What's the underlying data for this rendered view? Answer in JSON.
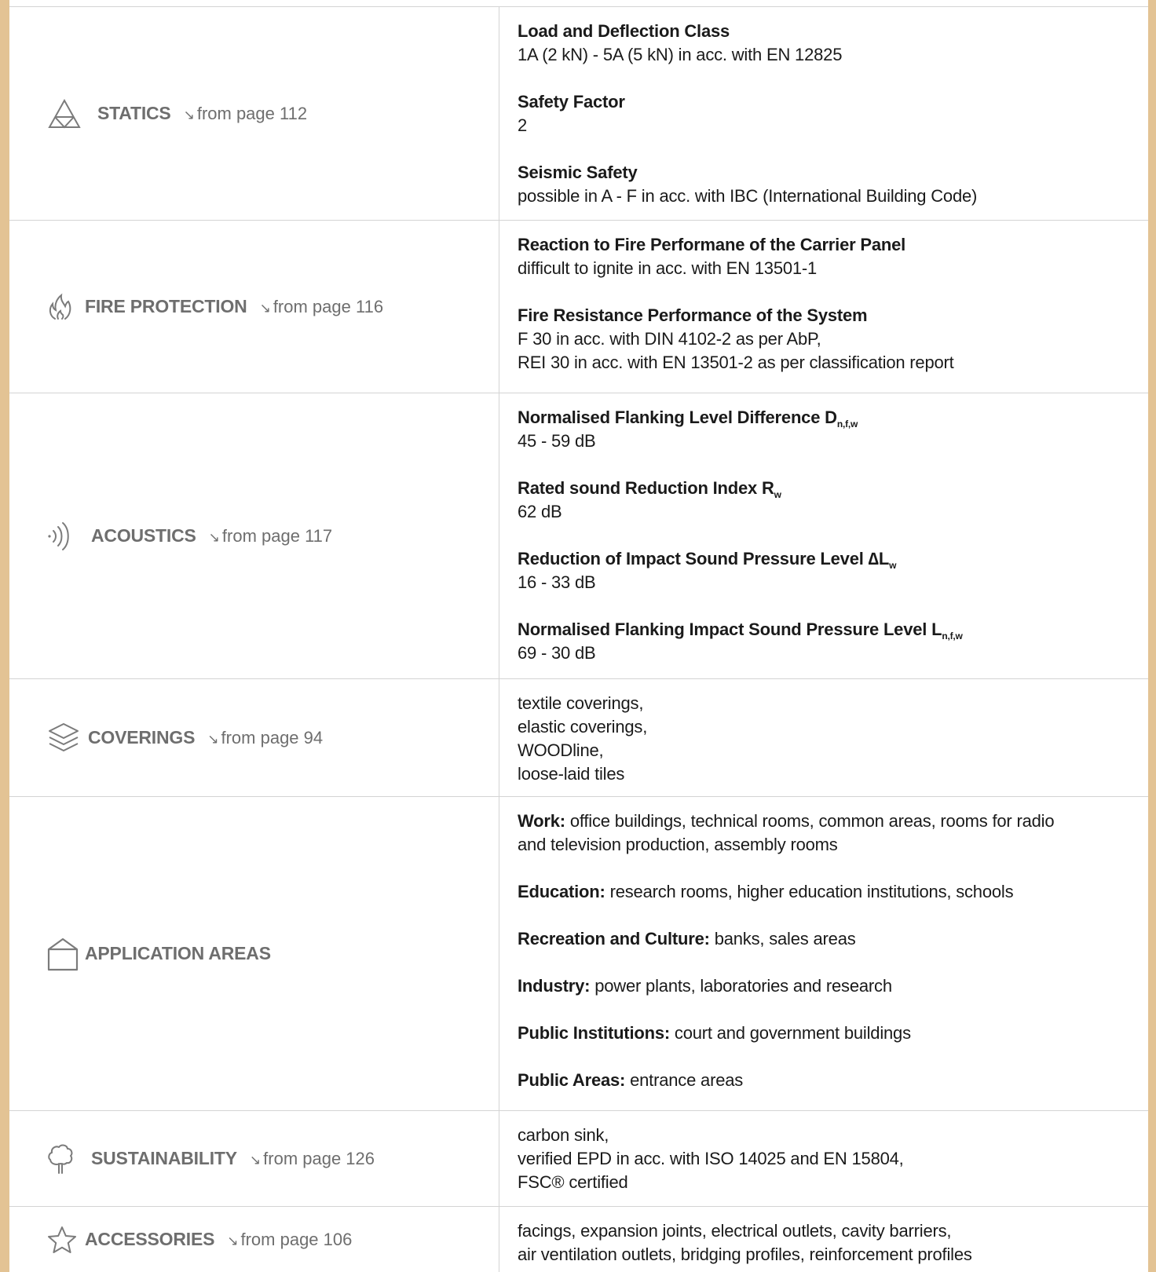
{
  "sections": [
    {
      "icon": "statics-icon",
      "category": "STATICS",
      "page_ref": "from page 112",
      "items": [
        {
          "title": "Load and Deflection Class",
          "value": "1A (2 kN) - 5A (5 kN) in acc. with EN 12825"
        },
        {
          "title": "Safety Factor",
          "value": "2"
        },
        {
          "title": "Seismic Safety",
          "value": "possible in A - F in acc. with IBC (International Building Code)"
        }
      ]
    },
    {
      "icon": "flame-icon",
      "category": "FIRE PROTECTION",
      "page_ref": "from page 116",
      "items": [
        {
          "title": "Reaction to Fire Performane of the Carrier Panel",
          "value": "difficult to ignite in acc. with EN 13501-1"
        },
        {
          "title": "Fire Resistance Performance of the System",
          "value_lines": [
            "F 30 in acc. with DIN 4102-2 as per AbP,",
            "REI 30 in acc. with EN 13501-2 as per classification report"
          ]
        }
      ]
    },
    {
      "icon": "sound-waves-icon",
      "category": "ACOUSTICS",
      "page_ref": "from page 117",
      "items": [
        {
          "title": "Normalised Flanking Level Difference D",
          "sub": "n,f,w",
          "value": "45 - 59 dB"
        },
        {
          "title": "Rated sound Reduction Index R",
          "sub": "w",
          "value": "62 dB"
        },
        {
          "title": "Reduction of Impact Sound Pressure Level ∆L",
          "sub": "w",
          "value": "16 - 33 dB"
        },
        {
          "title": "Normalised Flanking Impact Sound Pressure Level L",
          "sub": "n,f,w",
          "value": "69 - 30 dB"
        }
      ]
    },
    {
      "icon": "layers-icon",
      "category": "COVERINGS",
      "page_ref": "from page 94",
      "lines": [
        "textile coverings,",
        "elastic coverings,",
        "WOODline,",
        "loose-laid tiles"
      ]
    },
    {
      "icon": "house-icon",
      "category": "APPLICATION AREAS",
      "page_ref": "",
      "items": [
        {
          "label": "Work:",
          "text_lines": [
            " office buildings, technical rooms, common areas, rooms for radio",
            "and television production, assembly rooms"
          ]
        },
        {
          "label": "Education:",
          "text": " research rooms, higher education institutions, schools"
        },
        {
          "label": "Recreation and Culture:",
          "text": " banks, sales areas"
        },
        {
          "label": "Industry:",
          "text": " power plants, laboratories and research"
        },
        {
          "label": "Public Institutions:",
          "text": " court and government buildings"
        },
        {
          "label": "Public Areas:",
          "text": " entrance areas"
        }
      ]
    },
    {
      "icon": "tree-icon",
      "category": "SUSTAINABILITY",
      "page_ref": "from page 126",
      "lines": [
        "carbon sink,",
        "verified EPD in acc. with ISO 14025 and EN 15804,",
        "FSC® certified"
      ]
    },
    {
      "icon": "star-icon",
      "category": "ACCESSORIES",
      "page_ref": "from page 106",
      "lines": [
        "facings, expansion joints, electrical outlets, cavity barriers,",
        "air ventilation outlets, bridging profiles, reinforcement profiles"
      ]
    }
  ],
  "ref_arrow": "↘",
  "colors": {
    "border_accent": "#e3c394",
    "divider": "#d4d4d4",
    "category_text": "#6e6e6e"
  }
}
